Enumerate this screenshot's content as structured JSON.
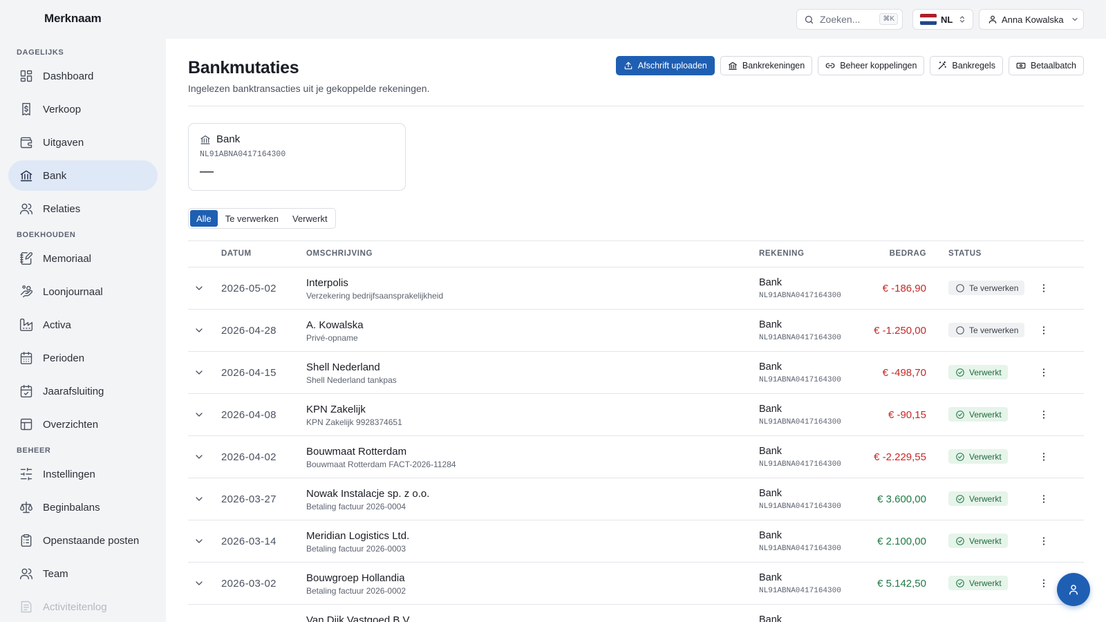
{
  "brand": "Merknaam",
  "sidebar": {
    "sections": [
      {
        "title": "DAGELIJKS",
        "items": [
          {
            "label": "Dashboard",
            "icon": "dashboard-icon"
          },
          {
            "label": "Verkoop",
            "icon": "invoice-dollar-icon"
          },
          {
            "label": "Uitgaven",
            "icon": "wallet-icon"
          },
          {
            "label": "Bank",
            "icon": "bank-icon",
            "active": true
          },
          {
            "label": "Relaties",
            "icon": "users-icon"
          }
        ]
      },
      {
        "title": "BOEKHOUDEN",
        "items": [
          {
            "label": "Memoriaal",
            "icon": "notebook-pen-icon"
          },
          {
            "label": "Loonjournaal",
            "icon": "hand-coins-icon"
          },
          {
            "label": "Activa",
            "icon": "factory-icon"
          },
          {
            "label": "Perioden",
            "icon": "calendar-icon"
          },
          {
            "label": "Jaarafsluiting",
            "icon": "calendar-check-icon"
          },
          {
            "label": "Overzichten",
            "icon": "table-icon"
          }
        ]
      },
      {
        "title": "BEHEER",
        "items": [
          {
            "label": "Instellingen",
            "icon": "sliders-icon"
          },
          {
            "label": "Beginbalans",
            "icon": "scale-icon"
          },
          {
            "label": "Openstaande posten",
            "icon": "clipboard-list-icon"
          },
          {
            "label": "Team",
            "icon": "users-icon"
          },
          {
            "label": "Activiteitenlog",
            "icon": "log-icon",
            "faded": true
          }
        ]
      }
    ]
  },
  "topbar": {
    "search_placeholder": "Zoeken...",
    "search_shortcut": "⌘K",
    "language": "NL",
    "user_name": "Anna Kowalska"
  },
  "page": {
    "title": "Bankmutaties",
    "subtitle": "Ingelezen banktransacties uit je gekoppelde rekeningen."
  },
  "actions": {
    "upload": "Afschrift uploaden",
    "accounts": "Bankrekeningen",
    "links": "Beheer koppelingen",
    "rules": "Bankregels",
    "batch": "Betaalbatch"
  },
  "account_card": {
    "name": "Bank",
    "iban": "NL91ABNA0417164300",
    "balance": "—"
  },
  "filters": {
    "all": "Alle",
    "pending": "Te verwerken",
    "done": "Verwerkt"
  },
  "table": {
    "headers": {
      "date": "DATUM",
      "description": "OMSCHRIJVING",
      "account": "REKENING",
      "amount": "BEDRAG",
      "status": "STATUS"
    },
    "rows": [
      {
        "date": "2026-05-02",
        "title": "Interpolis",
        "subtitle": "Verzekering bedrijfsaansprakelijkheid",
        "account": "Bank",
        "iban": "NL91ABNA0417164300",
        "amount": "€ -186,90",
        "sign": "neg",
        "status": "Te verwerken",
        "state": "pending"
      },
      {
        "date": "2026-04-28",
        "title": "A. Kowalska",
        "subtitle": "Privé-opname",
        "account": "Bank",
        "iban": "NL91ABNA0417164300",
        "amount": "€ -1.250,00",
        "sign": "neg",
        "status": "Te verwerken",
        "state": "pending"
      },
      {
        "date": "2026-04-15",
        "title": "Shell Nederland",
        "subtitle": "Shell Nederland tankpas",
        "account": "Bank",
        "iban": "NL91ABNA0417164300",
        "amount": "€ -498,70",
        "sign": "neg",
        "status": "Verwerkt",
        "state": "done"
      },
      {
        "date": "2026-04-08",
        "title": "KPN Zakelijk",
        "subtitle": "KPN Zakelijk 9928374651",
        "account": "Bank",
        "iban": "NL91ABNA0417164300",
        "amount": "€ -90,15",
        "sign": "neg",
        "status": "Verwerkt",
        "state": "done"
      },
      {
        "date": "2026-04-02",
        "title": "Bouwmaat Rotterdam",
        "subtitle": "Bouwmaat Rotterdam FACT-2026-11284",
        "account": "Bank",
        "iban": "NL91ABNA0417164300",
        "amount": "€ -2.229,55",
        "sign": "neg",
        "status": "Verwerkt",
        "state": "done"
      },
      {
        "date": "2026-03-27",
        "title": "Nowak Instalacje sp. z o.o.",
        "subtitle": "Betaling factuur 2026-0004",
        "account": "Bank",
        "iban": "NL91ABNA0417164300",
        "amount": "€ 3.600,00",
        "sign": "pos",
        "status": "Verwerkt",
        "state": "done"
      },
      {
        "date": "2026-03-14",
        "title": "Meridian Logistics Ltd.",
        "subtitle": "Betaling factuur 2026-0003",
        "account": "Bank",
        "iban": "NL91ABNA0417164300",
        "amount": "€ 2.100,00",
        "sign": "pos",
        "status": "Verwerkt",
        "state": "done"
      },
      {
        "date": "2026-03-02",
        "title": "Bouwgroep Hollandia",
        "subtitle": "Betaling factuur 2026-0002",
        "account": "Bank",
        "iban": "NL91ABNA0417164300",
        "amount": "€ 5.142,50",
        "sign": "pos",
        "status": "Verwerkt",
        "state": "done"
      },
      {
        "date": "",
        "title": "Van Dijk Vastgoed B.V.",
        "subtitle": "",
        "account": "Bank",
        "iban": "",
        "amount": "",
        "sign": "pos",
        "status": "",
        "state": "done"
      }
    ]
  },
  "colors": {
    "accent": "#1f5fb3",
    "negative": "#c62828",
    "positive": "#1e7a46",
    "active_nav": "#dfe8f6"
  }
}
